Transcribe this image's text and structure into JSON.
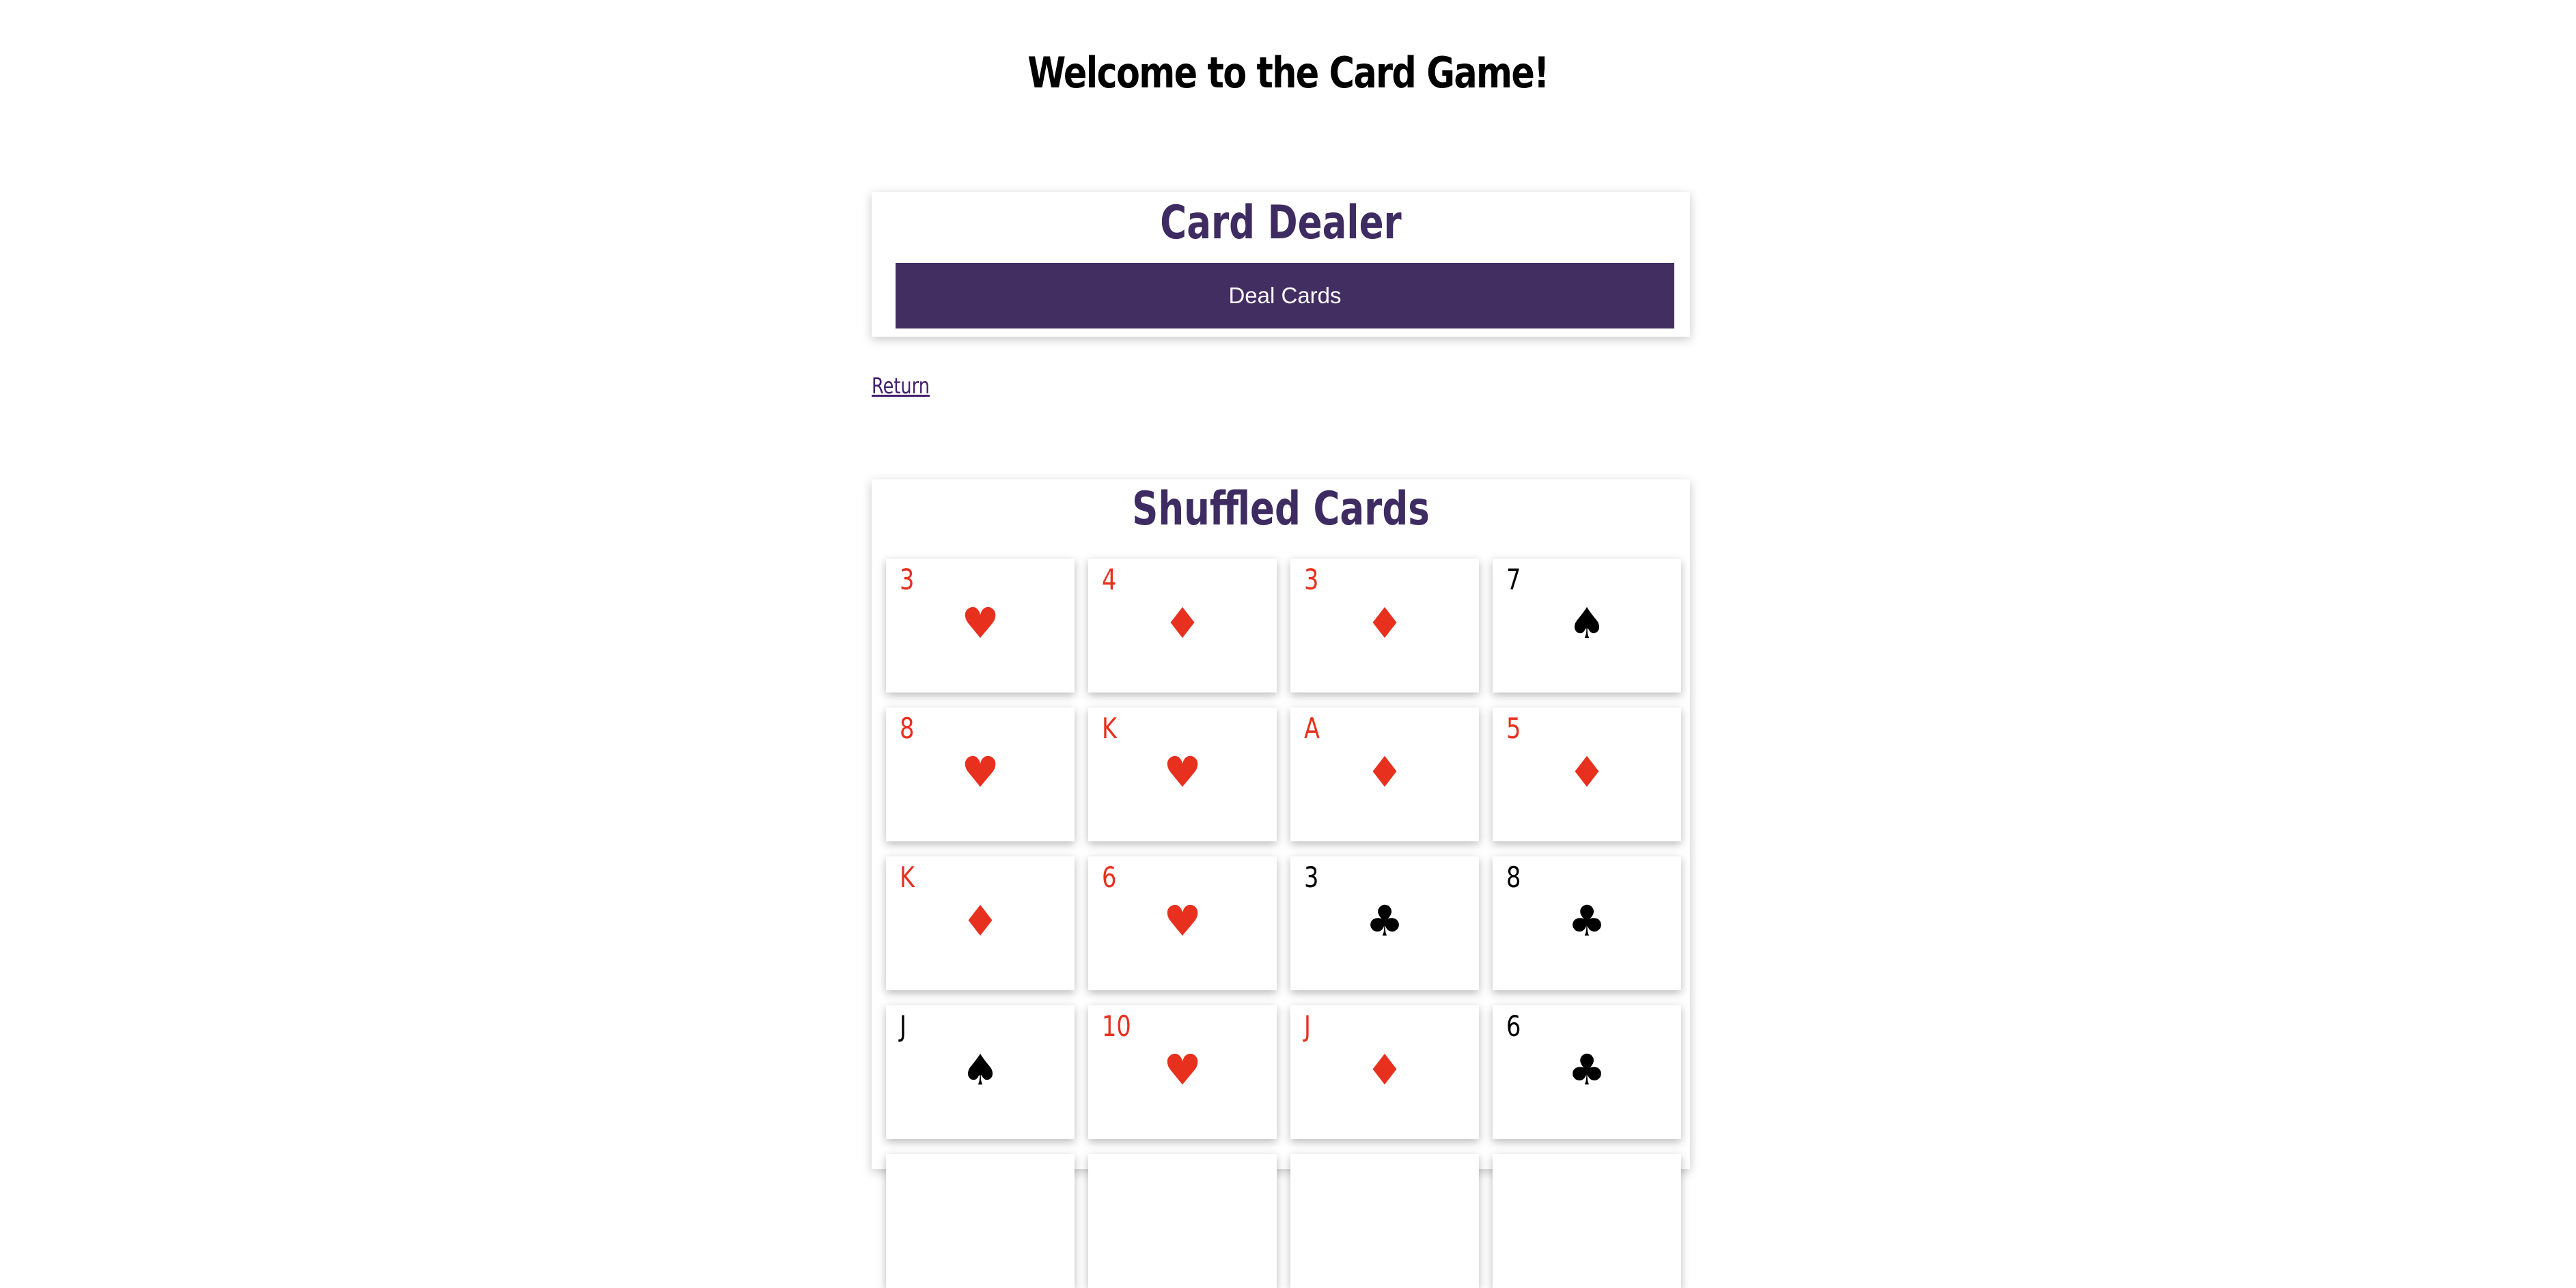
{
  "page": {
    "title": "Welcome to the Card Game!"
  },
  "dealer": {
    "title": "Card Dealer",
    "button_label": "Deal Cards"
  },
  "nav": {
    "return_label": "Return"
  },
  "shuffled": {
    "title": "Shuffled Cards",
    "cards": [
      {
        "rank": "3",
        "suit": "hearts",
        "suit_symbol": "♥",
        "color": "red"
      },
      {
        "rank": "4",
        "suit": "diamonds",
        "suit_symbol": "♦",
        "color": "red"
      },
      {
        "rank": "3",
        "suit": "diamonds",
        "suit_symbol": "♦",
        "color": "red"
      },
      {
        "rank": "7",
        "suit": "spades",
        "suit_symbol": "♠",
        "color": "black"
      },
      {
        "rank": "8",
        "suit": "hearts",
        "suit_symbol": "♥",
        "color": "red"
      },
      {
        "rank": "K",
        "suit": "hearts",
        "suit_symbol": "♥",
        "color": "red"
      },
      {
        "rank": "A",
        "suit": "diamonds",
        "suit_symbol": "♦",
        "color": "red"
      },
      {
        "rank": "5",
        "suit": "diamonds",
        "suit_symbol": "♦",
        "color": "red"
      },
      {
        "rank": "K",
        "suit": "diamonds",
        "suit_symbol": "♦",
        "color": "red"
      },
      {
        "rank": "6",
        "suit": "hearts",
        "suit_symbol": "♥",
        "color": "red"
      },
      {
        "rank": "3",
        "suit": "clubs",
        "suit_symbol": "♣",
        "color": "black"
      },
      {
        "rank": "8",
        "suit": "clubs",
        "suit_symbol": "♣",
        "color": "black"
      },
      {
        "rank": "J",
        "suit": "spades",
        "suit_symbol": "♠",
        "color": "black"
      },
      {
        "rank": "10",
        "suit": "hearts",
        "suit_symbol": "♥",
        "color": "red"
      },
      {
        "rank": "J",
        "suit": "diamonds",
        "suit_symbol": "♦",
        "color": "red"
      },
      {
        "rank": "6",
        "suit": "clubs",
        "suit_symbol": "♣",
        "color": "black"
      },
      {
        "rank": "",
        "suit": "",
        "suit_symbol": "",
        "color": "black"
      },
      {
        "rank": "",
        "suit": "",
        "suit_symbol": "",
        "color": "black"
      },
      {
        "rank": "",
        "suit": "",
        "suit_symbol": "",
        "color": "black"
      },
      {
        "rank": "",
        "suit": "",
        "suit_symbol": "",
        "color": "black"
      }
    ]
  },
  "colors": {
    "accent": "#432e62",
    "heading": "#3d2b62",
    "red_suit": "#e8301f",
    "link": "#43206e"
  }
}
